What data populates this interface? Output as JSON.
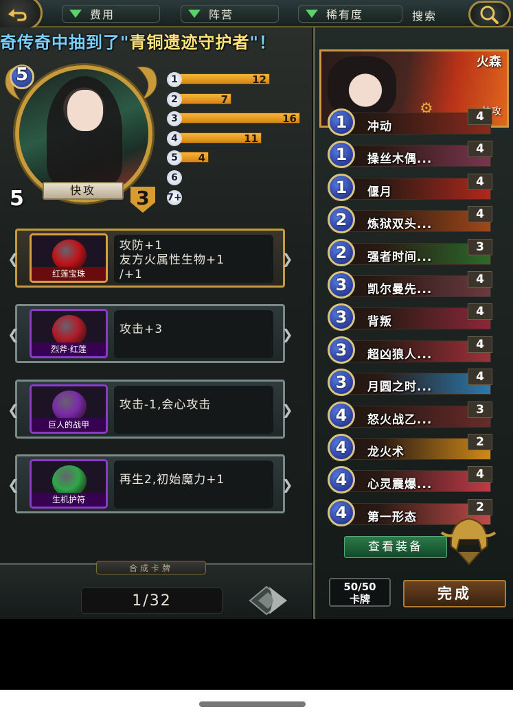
{
  "top_bar": {
    "filters": [
      {
        "label": "费用"
      },
      {
        "label": "阵营"
      },
      {
        "label": "稀有度"
      }
    ],
    "search_label": "搜索"
  },
  "ticker": {
    "prefix": "奇传奇中抽到了\"",
    "highlight": "青铜遗迹守护者",
    "suffix": "\"！"
  },
  "hero": {
    "cost": "5",
    "attack": "5",
    "health": "3",
    "name": "快攻"
  },
  "curve": [
    {
      "cost": "1",
      "count": 12,
      "label": "12"
    },
    {
      "cost": "2",
      "count": 7,
      "label": "7"
    },
    {
      "cost": "3",
      "count": 16,
      "label": "16"
    },
    {
      "cost": "4",
      "count": 11,
      "label": "11"
    },
    {
      "cost": "5",
      "count": 4,
      "label": "4"
    },
    {
      "cost": "6",
      "count": 0,
      "label": ""
    },
    {
      "cost": "7+",
      "count": 0,
      "label": ""
    }
  ],
  "equipment": [
    {
      "name": "红莲宝珠",
      "desc": "攻防+1\n友方火属性生物+1\n/+1",
      "color": "#c0141a",
      "style": "gold"
    },
    {
      "name": "烈斧·红莲",
      "desc": "攻击+3",
      "color": "#b01c2a",
      "style": "purple"
    },
    {
      "name": "巨人的战甲",
      "desc": "攻击-1,会心攻击",
      "color": "#7a2aa8",
      "style": "purple"
    },
    {
      "name": "生机护符",
      "desc": "再生2,初始魔力+1",
      "color": "#2ea84a",
      "style": "purple"
    }
  ],
  "bottom_left": {
    "synth_label": "合成卡牌",
    "page": "1/32"
  },
  "deck_hero": {
    "element": "火森",
    "class": "快攻"
  },
  "deck": [
    {
      "cost": "1",
      "name": "冲动",
      "count": "4",
      "color": "#8a2a1c"
    },
    {
      "cost": "1",
      "name": "操丝木偶...",
      "count": "4",
      "color": "#7a3550"
    },
    {
      "cost": "1",
      "name": "偃月",
      "count": "4",
      "color": "#b0281a"
    },
    {
      "cost": "2",
      "name": "炼狱双头...",
      "count": "4",
      "color": "#a04818"
    },
    {
      "cost": "2",
      "name": "强者时间...",
      "count": "3",
      "color": "#2a6a2a"
    },
    {
      "cost": "3",
      "name": "凯尔曼先...",
      "count": "4",
      "color": "#6a3a40"
    },
    {
      "cost": "3",
      "name": "背叛",
      "count": "4",
      "color": "#8a2838"
    },
    {
      "cost": "3",
      "name": "超凶狼人...",
      "count": "4",
      "color": "#a0303a"
    },
    {
      "cost": "3",
      "name": "月圆之时...",
      "count": "4",
      "color": "#2a7ab0"
    },
    {
      "cost": "4",
      "name": "怒火战乙...",
      "count": "3",
      "color": "#6a2a2a"
    },
    {
      "cost": "4",
      "name": "龙火术",
      "count": "2",
      "color": "#d08a18"
    },
    {
      "cost": "4",
      "name": "心灵震爆...",
      "count": "4",
      "color": "#c03a48"
    },
    {
      "cost": "4",
      "name": "第一形态",
      "count": "2",
      "color": "#c04a48"
    }
  ],
  "right_bottom": {
    "view_equip": "查看装备",
    "deck_count_top": "50/50",
    "deck_count_bottom": "卡牌",
    "done": "完成"
  }
}
